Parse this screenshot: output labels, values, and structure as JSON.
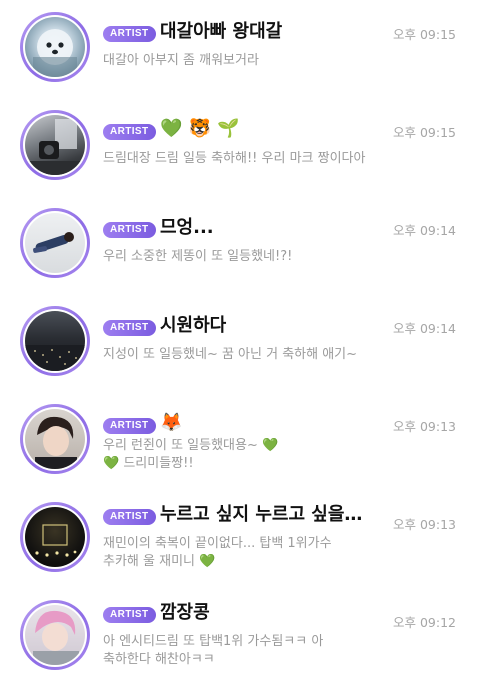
{
  "badge_label": "ARTIST",
  "colors": {
    "accent": "#8e6ce6",
    "badge": "#7b5ce0",
    "time": "#a6a6a6",
    "preview": "#9a9a9a"
  },
  "rows": [
    {
      "name": "대갈아빠 왕대갈",
      "time": "오후 09:15",
      "message": "대갈아 아부지 좀 깨워보거라",
      "avatar": "dog-photo"
    },
    {
      "name": "💚 🐯 🌱",
      "time": "오후 09:15",
      "message": "드림대장 드림 일등 축하해!! 우리 마크 짱이다아",
      "avatar": "room-mirror-photo"
    },
    {
      "name": "므엉...",
      "time": "오후 09:14",
      "message": "우리 소중한 제똥이 또 일등했네!?!",
      "avatar": "lying-on-floor-photo"
    },
    {
      "name": "시원하다",
      "time": "오후 09:14",
      "message": "지성이 또 일등했네~ 꿈 아닌 거 축하해 애기~",
      "avatar": "night-city-photo"
    },
    {
      "name": "🦊",
      "time": "오후 09:13",
      "message_line1": "우리 런쥔이 또 일등했대용~ 💚",
      "message_line2": "💚 드리미들짱!!",
      "avatar": "selfie-photo"
    },
    {
      "name": "누르고 싶지 누르고 싶을…",
      "time": "오후 09:13",
      "message_line1": "재민이의 축복이 끝이없다... 탑백 1위가수",
      "message_line2": "추카해 울 재미니 💚",
      "avatar": "stage-lights-photo"
    },
    {
      "name": "깜장콩",
      "time": "오후 09:12",
      "message_line1": "아 엔시티드림 또 탑백1위 가수됨ㅋㅋ 아",
      "message_line2": "축하한다 해찬아ㅋㅋ",
      "avatar": "pink-hair-photo"
    }
  ]
}
